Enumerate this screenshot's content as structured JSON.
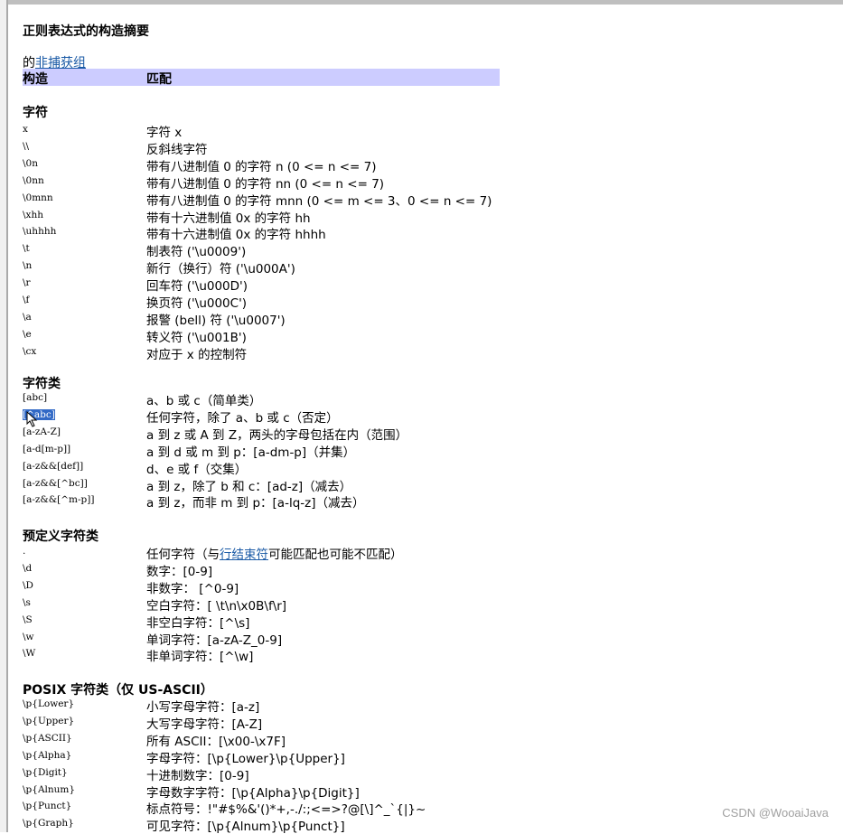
{
  "title": "正则表达式的构造摘要",
  "intro": {
    "prefix": "的",
    "link": "非捕获组"
  },
  "table_header": {
    "construct": "构造",
    "match": "匹配"
  },
  "sections": [
    {
      "name": "字符",
      "rows": [
        {
          "c": "x",
          "m": "字符 x"
        },
        {
          "c": "\\\\",
          "m": "反斜线字符"
        },
        {
          "c": "\\0n",
          "m": "带有八进制值 0 的字符 n (0 <= n <= 7)"
        },
        {
          "c": "\\0nn",
          "m": "带有八进制值 0 的字符 nn (0 <= n <= 7)"
        },
        {
          "c": "\\0mnn",
          "m": "带有八进制值 0 的字符 mnn (0 <= m <= 3、0 <= n <= 7)"
        },
        {
          "c": "\\xhh",
          "m": "带有十六进制值 0x 的字符 hh"
        },
        {
          "c": "\\uhhhh",
          "m": "带有十六进制值 0x 的字符 hhhh"
        },
        {
          "c": "\\t",
          "m": "制表符 ('\\u0009')"
        },
        {
          "c": "\\n",
          "m": "新行（换行）符 ('\\u000A')"
        },
        {
          "c": "\\r",
          "m": "回车符 ('\\u000D')"
        },
        {
          "c": "\\f",
          "m": "换页符 ('\\u000C')"
        },
        {
          "c": "\\a",
          "m": "报警 (bell) 符 ('\\u0007')"
        },
        {
          "c": "\\e",
          "m": "转义符 ('\\u001B')"
        },
        {
          "c": "\\cx",
          "m": "对应于 x 的控制符"
        }
      ]
    },
    {
      "name": "字符类",
      "rows": [
        {
          "c": "[abc]",
          "m": "a、b 或 c（简单类）"
        },
        {
          "c": "[^abc]",
          "m": "任何字符，除了 a、b 或 c（否定）",
          "selected": true
        },
        {
          "c": "[a-zA-Z]",
          "m": "a 到 z 或 A 到 Z，两头的字母包括在内（范围）"
        },
        {
          "c": "[a-d[m-p]]",
          "m": "a 到 d 或 m 到 p：[a-dm-p]（并集）"
        },
        {
          "c": "[a-z&&[def]]",
          "m": "d、e 或 f（交集）"
        },
        {
          "c": "[a-z&&[^bc]]",
          "m": "a 到 z，除了 b 和 c：[ad-z]（减去）"
        },
        {
          "c": "[a-z&&[^m-p]]",
          "m": "a 到 z，而非 m 到 p：[a-lq-z]（减去）"
        }
      ]
    },
    {
      "name": "预定义字符类",
      "rows": [
        {
          "c": ".",
          "m_prefix": "任何字符（与",
          "m_link": "行结束符",
          "m_suffix": "可能匹配也可能不匹配）"
        },
        {
          "c": "\\d",
          "m": "数字：[0-9]"
        },
        {
          "c": "\\D",
          "m": "非数字： [^0-9]"
        },
        {
          "c": "\\s",
          "m": "空白字符：[ \\t\\n\\x0B\\f\\r]"
        },
        {
          "c": "\\S",
          "m": "非空白字符：[^\\s]"
        },
        {
          "c": "\\w",
          "m": "单词字符：[a-zA-Z_0-9]"
        },
        {
          "c": "\\W",
          "m": "非单词字符：[^\\w]"
        }
      ]
    },
    {
      "name": "POSIX 字符类（仅 US-ASCII）",
      "rows": [
        {
          "c": "\\p{Lower}",
          "m": "小写字母字符：[a-z]"
        },
        {
          "c": "\\p{Upper}",
          "m": "大写字母字符：[A-Z]"
        },
        {
          "c": "\\p{ASCII}",
          "m": "所有 ASCII：[\\x00-\\x7F]"
        },
        {
          "c": "\\p{Alpha}",
          "m": "字母字符：[\\p{Lower}\\p{Upper}]"
        },
        {
          "c": "\\p{Digit}",
          "m": "十进制数字：[0-9]"
        },
        {
          "c": "\\p{Alnum}",
          "m": "字母数字字符：[\\p{Alpha}\\p{Digit}]"
        },
        {
          "c": "\\p{Punct}",
          "m": "标点符号：!\"#$%&'()*+,-./:;<=>?@[\\]^_`{|}~"
        },
        {
          "c": "\\p{Graph}",
          "m": "可见字符：[\\p{Alnum}\\p{Punct}]"
        }
      ]
    }
  ],
  "watermark": "CSDN @WooaiJava"
}
